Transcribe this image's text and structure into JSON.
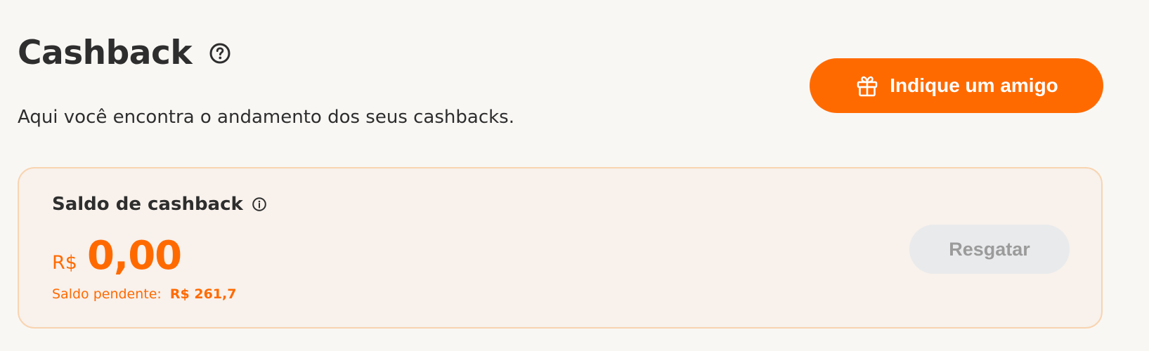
{
  "header": {
    "title": "Cashback",
    "help_icon": "question-circle-icon",
    "subtitle": "Aqui você encontra o andamento dos seus cashbacks."
  },
  "refer_button": {
    "icon": "gift-icon",
    "label": "Indique um amigo"
  },
  "balance_card": {
    "title": "Saldo de cashback",
    "info_icon": "info-circle-icon",
    "currency": "R$",
    "amount": "0,00",
    "pending_label": "Saldo pendente:",
    "pending_value": "R$ 261,7",
    "redeem_button": {
      "label": "Resgatar",
      "enabled": false
    }
  },
  "colors": {
    "accent": "#ff6a00",
    "background": "#f9f7f4",
    "card_background": "#f8f1ec",
    "card_border": "#f8d4b0",
    "disabled_button_bg": "#e9eaec",
    "disabled_button_text": "#9b9b9b",
    "text": "#2e2e2e"
  }
}
